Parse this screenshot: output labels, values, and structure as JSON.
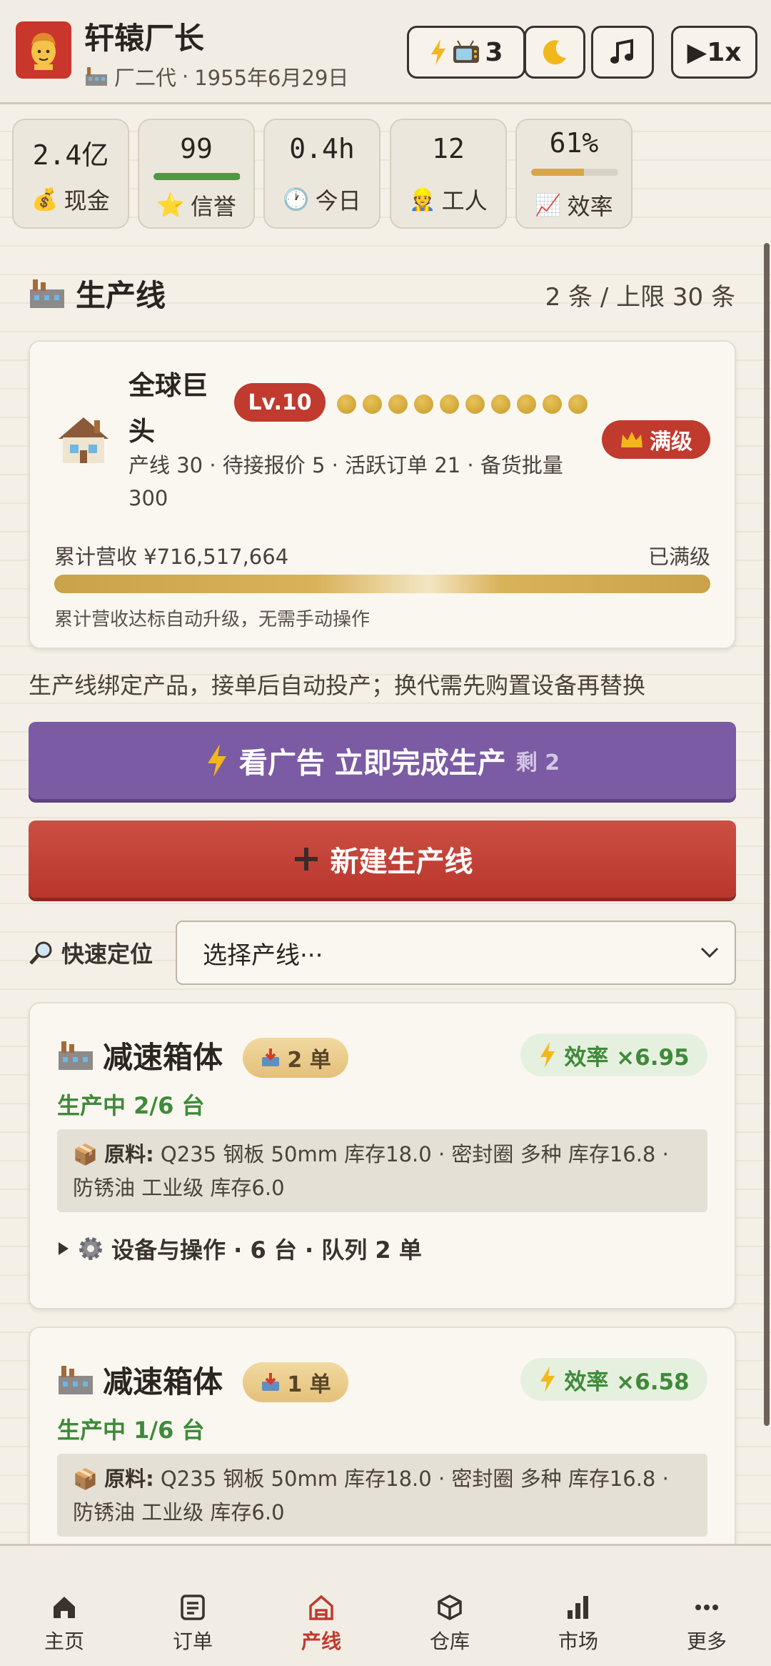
{
  "header": {
    "name": "轩辕厂长",
    "subtitle_role": "厂二代",
    "subtitle_sep": "·",
    "subtitle_date": "1955年6月29日",
    "ad_count": "3",
    "speed": "▶1x"
  },
  "stats": [
    {
      "value": "2.4亿",
      "label": "现金",
      "icon": "money-bag-icon"
    },
    {
      "value": "99",
      "label": "信誉",
      "icon": "star-icon",
      "bar_fraction": 0.99,
      "bar_color": "#4b9a45"
    },
    {
      "value": "0.4h",
      "label": "今日",
      "icon": "clock-icon"
    },
    {
      "value": "12",
      "label": "工人",
      "icon": "worker-icon"
    },
    {
      "value": "61%",
      "label": "效率",
      "icon": "chart-icon",
      "bar_fraction": 0.61,
      "bar_color": "#d6a64a"
    }
  ],
  "section": {
    "title": "生产线",
    "count": "2 条 / 上限 30 条"
  },
  "level_card": {
    "name": "全球巨头",
    "level": "Lv.10",
    "stars_filled": 10,
    "max_label": "满级",
    "desc": "产线 30 · 待接报价 5 · 活跃订单 21 · 备货批量 300",
    "revenue": "累计营收 ¥716,517,664",
    "revenue_status": "已满级",
    "note": "累计营收达标自动升级，无需手动操作"
  },
  "hint": "生产线绑定产品，接单后自动投产；换代需先购置设备再替换",
  "ad_button": {
    "label": "看广告 立即完成生产",
    "remain": "剩 2"
  },
  "new_button": {
    "label": "新建生产线"
  },
  "locate": {
    "label": "快速定位",
    "placeholder": "选择产线···"
  },
  "lines": [
    {
      "name": "减速箱体",
      "orders": "2 单",
      "efficiency": "效率 ×6.95",
      "status": "生产中 2/6 台",
      "materials_label": "原料:",
      "materials": "Q235 钢板 50mm 库存18.0 · 密封圈 多种 库存16.8 · 防锈油 工业级 库存6.0",
      "ops": "设备与操作 · 6 台 · 队列 2 单"
    },
    {
      "name": "减速箱体",
      "orders": "1 单",
      "efficiency": "效率 ×6.58",
      "status": "生产中 1/6 台",
      "materials_label": "原料:",
      "materials": "Q235 钢板 50mm 库存18.0 · 密封圈 多种 库存16.8 · 防锈油 工业级 库存6.0",
      "ops": ""
    }
  ],
  "nav": [
    {
      "label": "主页",
      "icon": "home-icon"
    },
    {
      "label": "订单",
      "icon": "orders-icon"
    },
    {
      "label": "产线",
      "icon": "factory-icon",
      "active": true
    },
    {
      "label": "仓库",
      "icon": "box-icon"
    },
    {
      "label": "市场",
      "icon": "bars-icon"
    },
    {
      "label": "更多",
      "icon": "more-icon"
    }
  ],
  "colors": {
    "accent_red": "#c13a2e",
    "purple": "#7b5ba3",
    "green": "#3f8a3a",
    "gold": "#d9b25a"
  }
}
